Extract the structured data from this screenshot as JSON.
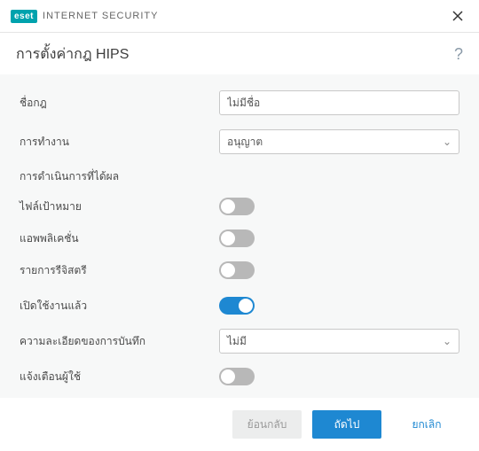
{
  "titlebar": {
    "brand_badge": "eset",
    "brand_text": "INTERNET SECURITY"
  },
  "header": {
    "title": "การตั้งค่ากฎ HIPS",
    "help": "?"
  },
  "form": {
    "rule_name_label": "ชื่อกฎ",
    "rule_name_value": "ไม่มีชื่อ",
    "action_label": "การทำงาน",
    "action_value": "อนุญาต",
    "operations_section": "การดำเนินการที่ได้ผล",
    "target_files_label": "ไฟล์เป้าหมาย",
    "applications_label": "แอพพลิเคชั่น",
    "registry_label": "รายการรีจิสตรี",
    "enabled_label": "เปิดใช้งานแล้ว",
    "log_detail_label": "ความละเอียดของการบันทึก",
    "log_detail_value": "ไม่มี",
    "notify_label": "แจ้งเตือนผู้ใช้"
  },
  "toggles": {
    "target_files": false,
    "applications": false,
    "registry": false,
    "enabled": true,
    "notify": false
  },
  "footer": {
    "back": "ย้อนกลับ",
    "next": "ถัดไป",
    "cancel": "ยกเลิก"
  }
}
